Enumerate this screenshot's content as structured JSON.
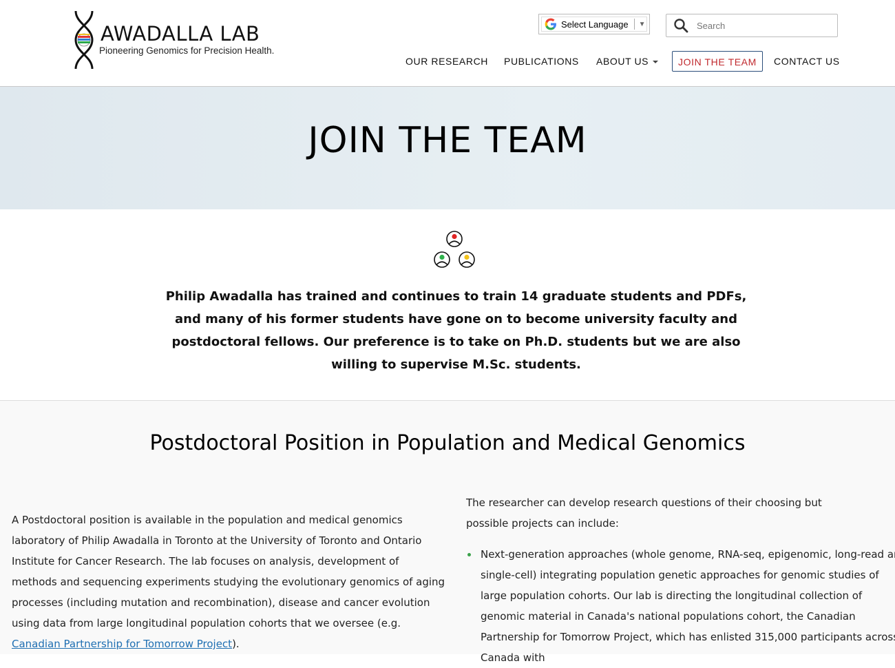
{
  "header": {
    "logo_title": "AWADALLA LAB",
    "logo_tagline": "Pioneering Genomics for Precision Health.",
    "language_select": "Select Language",
    "search_placeholder": "Search",
    "nav": [
      {
        "label": "OUR RESEARCH"
      },
      {
        "label": "PUBLICATIONS"
      },
      {
        "label": "ABOUT US"
      },
      {
        "label": "JOIN THE TEAM",
        "active": true
      },
      {
        "label": "CONTACT US"
      }
    ]
  },
  "hero": {
    "title": "JOIN THE TEAM"
  },
  "intro": {
    "text": "Philip Awadalla has trained and continues to train 14 graduate students and PDFs, and many of his former students have gone on to become university faculty and postdoctoral fellows. Our preference is to take on Ph.D. students but we are also willing to supervise M.Sc. students."
  },
  "section": {
    "title": "Postdoctoral Position in Population and Medical Genomics",
    "left_text": "A Postdoctoral position is available in the population and medical genomics laboratory of Philip Awadalla in Toronto at the University of Toronto and Ontario Institute for Cancer Research. The lab focuses on analysis, development of methods and sequencing experiments studying the evolutionary genomics of aging processes (including mutation and recombination), disease and cancer evolution using data from large longitudinal population cohorts that we oversee (e.g. ",
    "left_link": "Canadian Partnership for Tomorrow Project",
    "left_end": ").",
    "right_intro": "The researcher can develop research questions of their choosing but possible projects can include:",
    "bullets": [
      "Next-generation approaches (whole genome, RNA-seq, epigenomic, long-read and single-cell) integrating population genetic approaches for genomic studies of large population cohorts. Our lab is directing the longitudinal collection of genomic material in Canada's national populations cohort, the Canadian Partnership for Tomorrow Project, which has enlisted 315,000 participants across Canada with"
    ]
  },
  "colors": {
    "active_nav": "#c0282d",
    "link": "#1f6fb2",
    "bullet": "#3aa14a",
    "hero_bg": "#e3ecf2"
  },
  "icons": [
    "dna-logo-icon",
    "google-g-icon",
    "search-icon",
    "team-people-icon"
  ]
}
